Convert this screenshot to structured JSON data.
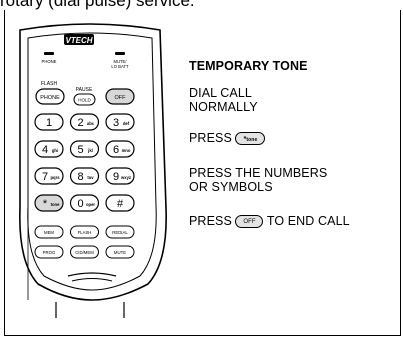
{
  "header_fragment": "rotary (dial pulse) service.",
  "phone": {
    "brand": "VTECH",
    "top_left_label": "PHONE",
    "top_right_label_1": "MUTE/",
    "top_right_label_2": "LO BATT",
    "flash_label": "FLASH",
    "pause_label": "PAUSE",
    "phone_key": "PHONE",
    "hold_key": "HOLD",
    "off_key": "OFF",
    "keys": [
      {
        "main": "1",
        "sub": ""
      },
      {
        "main": "2",
        "sub": "abc"
      },
      {
        "main": "3",
        "sub": "def"
      },
      {
        "main": "4",
        "sub": "ghi"
      },
      {
        "main": "5",
        "sub": "jkl"
      },
      {
        "main": "6",
        "sub": "mno"
      },
      {
        "main": "7",
        "sub": "pqrs"
      },
      {
        "main": "8",
        "sub": "tuv"
      },
      {
        "main": "9",
        "sub": "wxyz"
      },
      {
        "main": "*",
        "sub": "tone"
      },
      {
        "main": "0",
        "sub": "oper"
      },
      {
        "main": "#",
        "sub": ""
      }
    ],
    "fn_row1": [
      "MEM",
      "FLASH",
      "REDIAL"
    ],
    "fn_row2": [
      "PROG",
      "CID/MEM",
      "MUTE"
    ]
  },
  "instructions": {
    "title": "TEMPORARY TONE",
    "step1_line1": "DIAL  CALL",
    "step1_line2": "NORMALLY",
    "step2_prefix": "PRESS",
    "step2_key_main": "*",
    "step2_key_sub": "tone",
    "step3_line1": "PRESS THE NUMBERS",
    "step3_line2": "OR SYMBOLS",
    "step4_prefix": "PRESS",
    "step4_key": "OFF",
    "step4_suffix": "TO END CALL"
  }
}
